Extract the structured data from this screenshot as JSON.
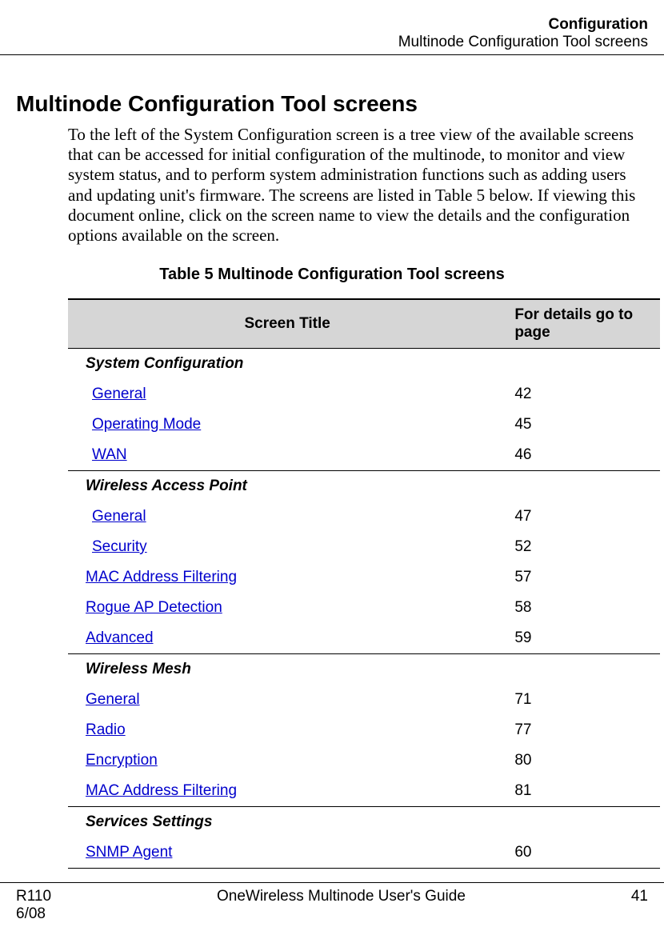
{
  "running_head": {
    "line1": "Configuration",
    "line2": "Multinode Configuration Tool screens"
  },
  "section": {
    "heading": "Multinode Configuration Tool screens",
    "intro": "To the left of the System Configuration screen is a tree view of the available screens that can be accessed for initial configuration of the multinode, to monitor and view system status, and to perform system administration functions such as adding users and updating unit's firmware.  The screens are listed in Table 5 below.  If viewing this document online, click on the screen name to view the details and the configuration options available on the screen."
  },
  "table": {
    "caption": "Table 5  Multinode Configuration Tool screens",
    "headers": {
      "title": "Screen Title",
      "page": "For details go to page"
    },
    "groups": [
      {
        "category": "System Configuration",
        "rows": [
          {
            "label": "General",
            "page": "42",
            "indent": 1
          },
          {
            "label": "Operating Mode",
            "page": "45",
            "indent": 1
          },
          {
            "label": "WAN",
            "page": "46",
            "indent": 1
          }
        ]
      },
      {
        "category": "Wireless Access Point",
        "rows": [
          {
            "label": "General",
            "page": "47",
            "indent": 1
          },
          {
            "label": "Security",
            "page": "52",
            "indent": 1
          },
          {
            "label": "MAC Address Filtering",
            "page": "57",
            "indent": 2
          },
          {
            "label": "Rogue AP Detection",
            "page": "58",
            "indent": 2
          },
          {
            "label": "Advanced",
            "page": "59",
            "indent": 2
          }
        ]
      },
      {
        "category": "Wireless Mesh",
        "rows": [
          {
            "label": "General",
            "page": "71",
            "indent": 2
          },
          {
            "label": "Radio",
            "page": "77",
            "indent": 2
          },
          {
            "label": "Encryption",
            "page": "80",
            "indent": 2
          },
          {
            "label": "MAC Address Filtering",
            "page": "81",
            "indent": 2
          }
        ]
      },
      {
        "category": "Services Settings",
        "rows": [
          {
            "label": "SNMP Agent",
            "page": "60",
            "indent": 2
          }
        ]
      }
    ]
  },
  "footer": {
    "left_line1": "R110",
    "left_line2": "6/08",
    "center": "OneWireless Multinode User's Guide",
    "right": "41"
  }
}
